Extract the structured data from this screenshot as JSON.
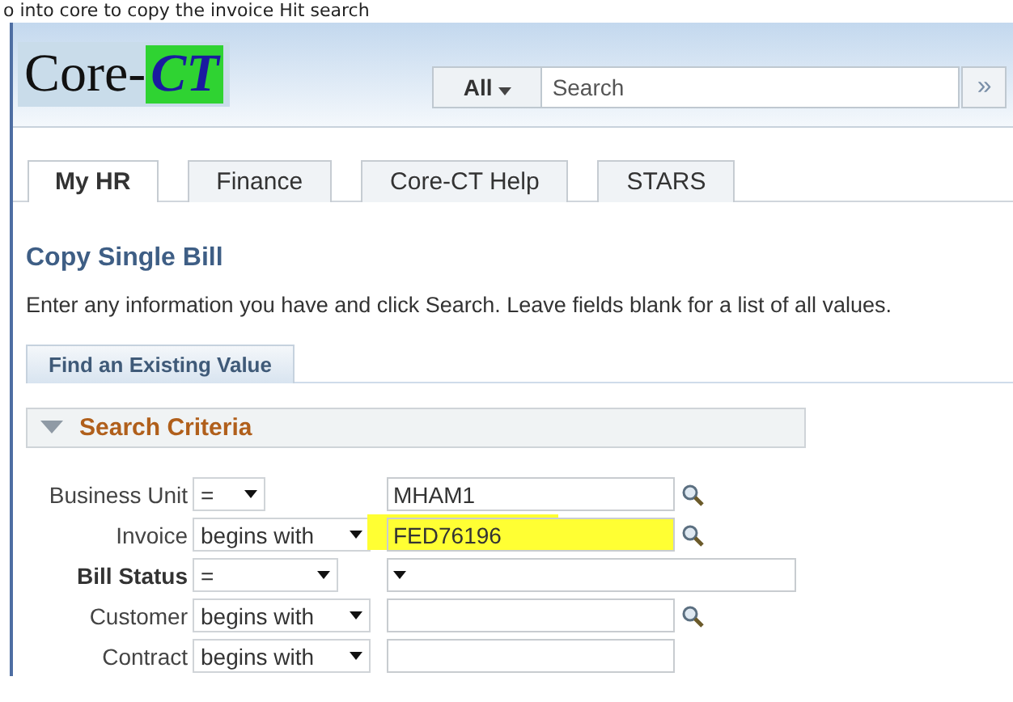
{
  "caption": "o into core to copy the invoice  Hit search",
  "header": {
    "logo": {
      "text": "Core-",
      "accent": "CT"
    },
    "search": {
      "scope": "All",
      "placeholder": "Search",
      "go": "»"
    }
  },
  "tabs": [
    {
      "label": "My HR",
      "selected": true
    },
    {
      "label": "Finance",
      "selected": false
    },
    {
      "label": "Core-CT Help",
      "selected": false
    },
    {
      "label": "STARS",
      "selected": false
    }
  ],
  "page_title": "Copy Single Bill",
  "instructions": "Enter any information you have and click Search. Leave fields blank for a list of all values.",
  "subtab": {
    "label": "Find an Existing Value",
    "selected": true
  },
  "section": {
    "title": "Search Criteria",
    "expanded": true
  },
  "fields": [
    {
      "label": "Business Unit",
      "required": false,
      "operator": "=",
      "kind": "lookup",
      "value": "MHAM1",
      "highlighted": false
    },
    {
      "label": "Invoice",
      "required": false,
      "operator": "begins with",
      "kind": "lookup",
      "value": "FED76196",
      "highlighted": true
    },
    {
      "label": "Bill Status",
      "required": true,
      "operator": "=",
      "kind": "dropdown",
      "highlighted": false
    },
    {
      "label": "Customer",
      "required": false,
      "operator": "begins with",
      "kind": "lookup",
      "highlighted": false
    },
    {
      "label": "Contract",
      "required": false,
      "operator": "begins with",
      "kind": "text",
      "highlighted": false
    }
  ]
}
